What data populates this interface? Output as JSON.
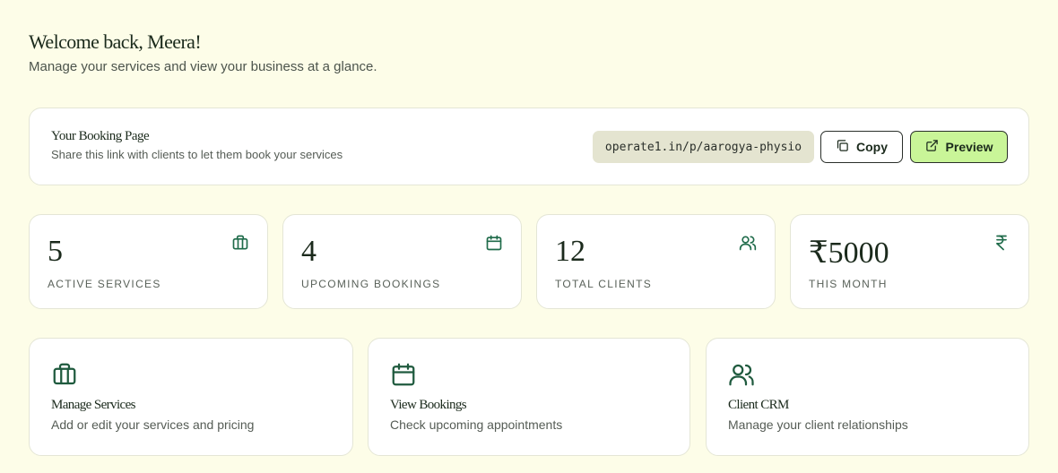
{
  "header": {
    "title": "Welcome back, Meera!",
    "subtitle": "Manage your services and view your business at a glance."
  },
  "booking_page": {
    "title": "Your Booking Page",
    "subtitle": "Share this link with clients to let them book your services",
    "link": "operate1.in/p/aarogya-physio",
    "copy_label": "Copy",
    "preview_label": "Preview"
  },
  "stats": [
    {
      "value": "5",
      "label": "ACTIVE SERVICES",
      "icon": "briefcase-icon"
    },
    {
      "value": "4",
      "label": "UPCOMING BOOKINGS",
      "icon": "calendar-icon"
    },
    {
      "value": "12",
      "label": "TOTAL CLIENTS",
      "icon": "users-icon"
    },
    {
      "value": "₹5000",
      "label": "THIS MONTH",
      "icon": "rupee-icon"
    }
  ],
  "actions": [
    {
      "title": "Manage Services",
      "subtitle": "Add or edit your services and pricing",
      "icon": "briefcase-icon"
    },
    {
      "title": "View Bookings",
      "subtitle": "Check upcoming appointments",
      "icon": "calendar-icon"
    },
    {
      "title": "Client CRM",
      "subtitle": "Manage your client relationships",
      "icon": "users-icon"
    }
  ],
  "colors": {
    "background": "#fdfde8",
    "accent_green": "#1f6b4a",
    "preview_button": "#c9f598"
  }
}
